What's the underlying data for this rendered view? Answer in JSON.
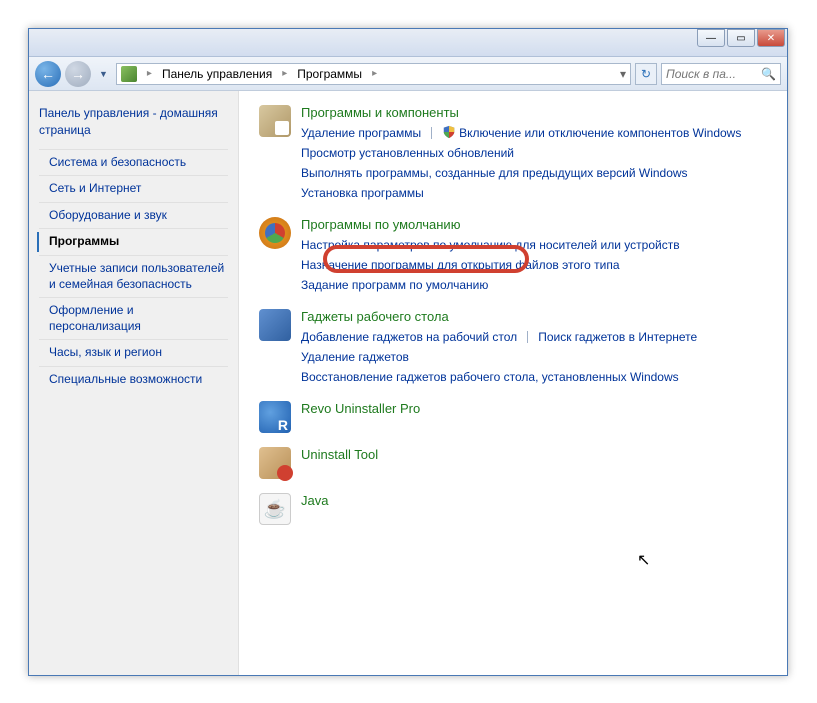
{
  "breadcrumb": {
    "root": "Панель управления",
    "current": "Программы"
  },
  "search": {
    "placeholder": "Поиск в па..."
  },
  "sidebar": {
    "home": "Панель управления - домашняя страница",
    "items": [
      {
        "label": "Система и безопасность"
      },
      {
        "label": "Сеть и Интернет"
      },
      {
        "label": "Оборудование и звук"
      },
      {
        "label": "Программы",
        "active": true
      },
      {
        "label": "Учетные записи пользователей и семейная безопасность"
      },
      {
        "label": "Оформление и персонализация"
      },
      {
        "label": "Часы, язык и регион"
      },
      {
        "label": "Специальные возможности"
      }
    ]
  },
  "categories": [
    {
      "icon": "programs",
      "title": "Программы и компоненты",
      "links": [
        {
          "text": "Удаление программы"
        },
        {
          "text": "Включение или отключение компонентов Windows",
          "shield": true,
          "sep_before": true
        },
        {
          "text": "Просмотр установленных обновлений",
          "newline_before": true
        },
        {
          "text": "Выполнять программы, созданные для предыдущих версий Windows",
          "newline_before": true
        },
        {
          "text": "Установка программы",
          "newline_before": true
        }
      ]
    },
    {
      "icon": "defaults",
      "title": "Программы по умолчанию",
      "highlighted": true,
      "links": [
        {
          "text": "Настройка параметров по умолчанию для носителей или устройств"
        },
        {
          "text": "Назначение программы для открытия файлов этого типа",
          "newline_before": true
        },
        {
          "text": "Задание программ по умолчанию",
          "newline_before": true
        }
      ]
    },
    {
      "icon": "gadgets",
      "title": "Гаджеты рабочего стола",
      "links": [
        {
          "text": "Добавление гаджетов на рабочий стол"
        },
        {
          "text": "Поиск гаджетов в Интернете",
          "sep_before": true
        },
        {
          "text": "Удаление гаджетов",
          "newline_before": true
        },
        {
          "text": "Восстановление гаджетов рабочего стола, установленных Windows",
          "newline_before": true
        }
      ]
    },
    {
      "icon": "revo",
      "title": "Revo Uninstaller Pro",
      "links": []
    },
    {
      "icon": "uninstall",
      "title": "Uninstall Tool",
      "links": []
    },
    {
      "icon": "java",
      "title": "Java",
      "links": []
    }
  ]
}
